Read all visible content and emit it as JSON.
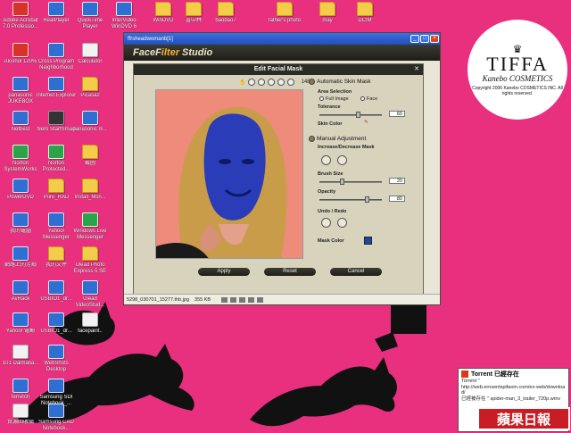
{
  "desktop": {
    "icons": [
      {
        "label": "Adobe Acrobat 7.0 Professio...",
        "kind": "red"
      },
      {
        "label": "RealPlayer",
        "kind": "blue"
      },
      {
        "label": "QuickTime Player",
        "kind": "blue"
      },
      {
        "label": "InterVideo WinDVD 6",
        "kind": "blue"
      },
      {
        "label": "WinDVD",
        "kind": "folder"
      },
      {
        "label": "喜中林",
        "kind": "folder"
      },
      {
        "label": "baobao7",
        "kind": "folder"
      },
      {
        "label": "father's photo",
        "kind": "folder"
      },
      {
        "label": "may",
        "kind": "folder"
      },
      {
        "label": "DCIM",
        "kind": "folder"
      },
      {
        "label": "Alcohol 120%",
        "kind": "red"
      },
      {
        "label": "Cross Program Neighborhood",
        "kind": "blue"
      },
      {
        "label": "Calculator",
        "kind": "white"
      },
      {
        "label": "panasonic JUKEBOX",
        "kind": "blue"
      },
      {
        "label": "Internet Explorer",
        "kind": "blue"
      },
      {
        "label": "Picasa2",
        "kind": "folder"
      },
      {
        "label": "Netbest",
        "kind": "blue"
      },
      {
        "label": "Nero StartSmart",
        "kind": "dark"
      },
      {
        "label": "panasonic m...",
        "kind": "blue"
      },
      {
        "label": "Norton SystemWorks",
        "kind": "green"
      },
      {
        "label": "Norton Protected...",
        "kind": "green"
      },
      {
        "label": "截圖",
        "kind": "folder"
      },
      {
        "label": "PowerDVD",
        "kind": "blue"
      },
      {
        "label": "Pure_RAD",
        "kind": "folder"
      },
      {
        "label": "Install_Msn...",
        "kind": "folder"
      },
      {
        "label": "我的電腦",
        "kind": "blue"
      },
      {
        "label": "Yahoo! Messenger",
        "kind": "blue"
      },
      {
        "label": "Windows Live Messenger",
        "kind": "green"
      },
      {
        "label": "網路上的芳鄰",
        "kind": "blue"
      },
      {
        "label": "我的文件",
        "kind": "folder"
      },
      {
        "label": "Ulead Photo Express 5 SE",
        "kind": "folder"
      },
      {
        "label": "AvRack",
        "kind": "blue"
      },
      {
        "label": "USBIO1_dr...",
        "kind": "blue"
      },
      {
        "label": "Ulead VideoStud...",
        "kind": "blue"
      },
      {
        "label": "Yahoo! 電郵",
        "kind": "blue"
      },
      {
        "label": "USBIO1_dr...",
        "kind": "blue"
      },
      {
        "label": "facepaint..",
        "kind": "white"
      },
      {
        "label": "101 Dalmatia...",
        "kind": "white"
      },
      {
        "label": "WebShots Desktop",
        "kind": "blue"
      },
      {
        "label": "ferretch",
        "kind": "blue"
      },
      {
        "label": "Samsung SDI Notebook_...",
        "kind": "blue"
      },
      {
        "label": "資源回收筒",
        "kind": "white"
      },
      {
        "label": "Samsung CAD Notebook...",
        "kind": "blue"
      }
    ],
    "logo": {
      "brand": "TIFFA",
      "subbrand": "Kanebo COSMETICS",
      "copyright": "Copyright 2006 Kanebo COSMETICS INC. All rights reserved."
    }
  },
  "window": {
    "title": "ffrsheadwomanb[1]",
    "app_name_part1": "FaceF",
    "app_name_part2": "ilter",
    "app_name_part3": " Studio",
    "status_file": "5298_030701_15277.thb.jpg",
    "status_size": "355 KB"
  },
  "dialog": {
    "title": "Edit Facial Mask",
    "close_glyph": "✕",
    "zoom": "148%",
    "auto": {
      "label": "Automatic Skin Mask",
      "area_label": "Area Selection",
      "option_full": "Full Image",
      "option_face": "Face",
      "tolerance_label": "Tolerance",
      "tolerance_value": "60",
      "tolerance_level": 0.62,
      "skin_label": "Skin Color"
    },
    "manual": {
      "label": "Manual Adjustment",
      "incdec_label": "Increase/Decrease Mask",
      "brush_label": "Brush Size",
      "brush_value": "20",
      "brush_level": 0.35,
      "opacity_label": "Opacity",
      "opacity_value": "80",
      "opacity_level": 0.78,
      "undo_label": "Undo / Redo",
      "mask_color_label": "Mask Color"
    },
    "buttons": {
      "apply": "Apply",
      "reset": "Reset",
      "cancel": "Cancel"
    }
  },
  "popup": {
    "title": "Torrent 已經存在",
    "line1": "Torrent \"",
    "line2": "http://web.ernsentspifaom.com/ex-web/download/",
    "line3": "已經被存在 \" spider-man_3_trailer_720p.wmv",
    "news_logo": "蘋果日報"
  },
  "colors": {
    "desktop_bg": "#e8307e",
    "mask_blue": "#2a3cb8",
    "mask_color_swatch": "#1d47a8"
  }
}
